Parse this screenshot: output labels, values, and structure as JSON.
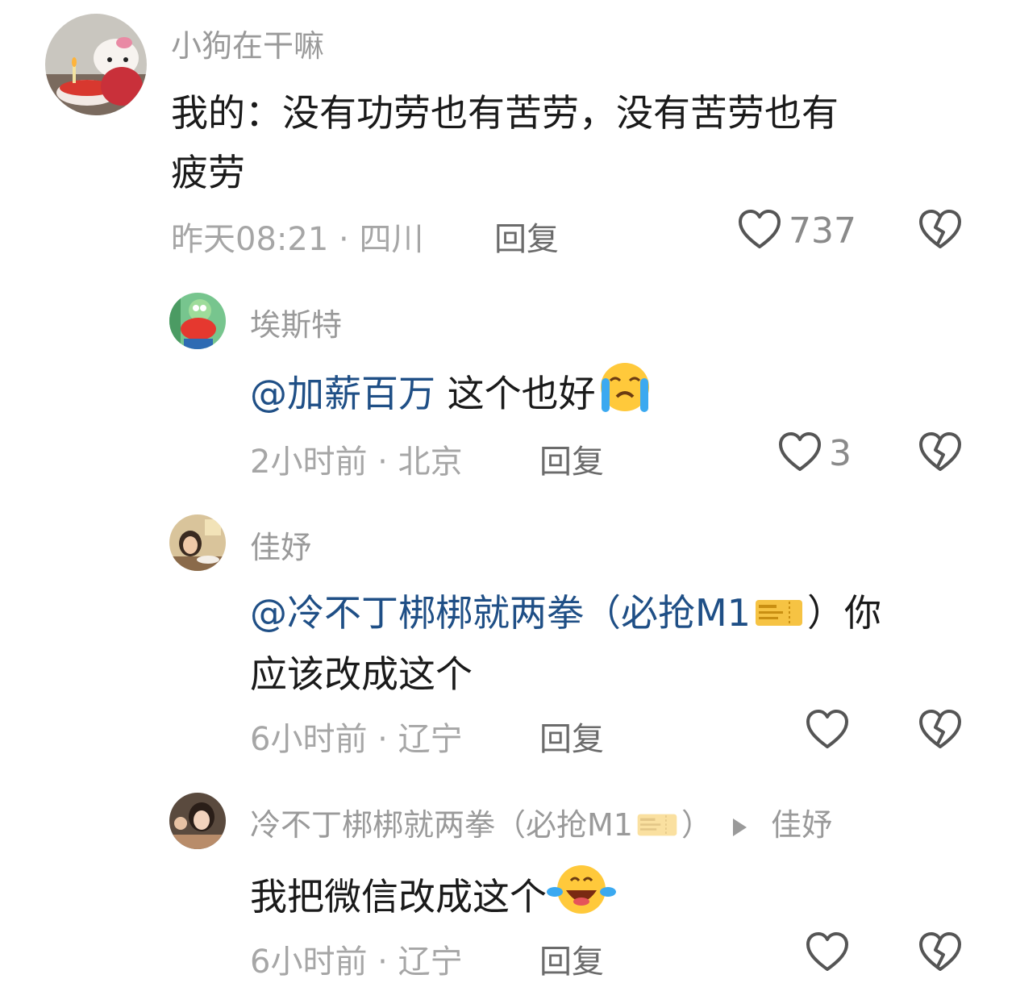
{
  "comments": [
    {
      "username": "小狗在干嘛",
      "text_line1": "我的：没有功劳也有苦劳，没有苦劳也有",
      "text_line2": "疲劳",
      "time": "昨天08:21",
      "location": "四川",
      "reply_label": "回复",
      "likes": "737"
    },
    {
      "username": "埃斯特",
      "mention": "@加薪百万",
      "text": " 这个也好",
      "time": "2小时前",
      "location": "北京",
      "reply_label": "回复",
      "likes": "3"
    },
    {
      "username": "佳妤",
      "mention": "@冷不丁梆梆就两拳（必抢M1",
      "text_line1_end": "）你",
      "text_line2": "应该改成这个",
      "time": "6小时前",
      "location": "辽宁",
      "reply_label": "回复"
    },
    {
      "username": "冷不丁梆梆就两拳（必抢M1",
      "username_end": "）",
      "reply_to": "佳妤",
      "text": "我把微信改成这个",
      "time": "6小时前",
      "location": "辽宁",
      "reply_label": "回复"
    }
  ],
  "separator": " · ",
  "colors": {
    "mention": "#1f4f86",
    "meta": "#a6a6a6",
    "username": "#9a9a9a",
    "text": "#1a1a1a"
  },
  "icons": [
    "heart-icon",
    "broken-heart-icon",
    "crying-face-emoji",
    "laughing-crying-emoji",
    "ticket-emoji",
    "triangle-right-icon"
  ]
}
